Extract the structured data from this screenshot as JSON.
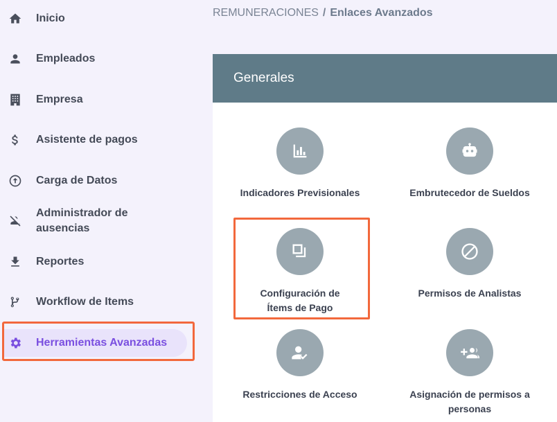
{
  "sidebar": {
    "items": [
      {
        "label": "Inicio",
        "icon": "home-icon"
      },
      {
        "label": "Empleados",
        "icon": "person-icon"
      },
      {
        "label": "Empresa",
        "icon": "building-icon"
      },
      {
        "label": "Asistente de pagos",
        "icon": "dollar-icon"
      },
      {
        "label": "Carga de Datos",
        "icon": "upload-circle-icon"
      },
      {
        "label": "Administrador de ausencias",
        "icon": "person-off-icon"
      },
      {
        "label": "Reportes",
        "icon": "download-icon"
      },
      {
        "label": "Workflow de Items",
        "icon": "branch-icon"
      },
      {
        "label": "Herramientas Avanzadas",
        "icon": "gear-icon",
        "active": true
      }
    ]
  },
  "breadcrumb": {
    "root": "REMUNERACIONES",
    "separator": "/",
    "current": "Enlaces Avanzados"
  },
  "panel": {
    "title": "Generales",
    "tools": [
      {
        "label": "Indicadores Previsionales",
        "icon": "bar-chart-icon"
      },
      {
        "label": "Embrutecedor de Sueldos",
        "icon": "robot-icon"
      },
      {
        "label": "Configuración de Ítems de Pago",
        "icon": "layers-icon"
      },
      {
        "label": "Permisos de Analistas",
        "icon": "block-icon"
      },
      {
        "label": "Restricciones de Acceso",
        "icon": "person-check-icon"
      },
      {
        "label": "Asignación de permisos a personas",
        "icon": "group-add-icon"
      }
    ]
  },
  "colors": {
    "accent": "#7a4fe0",
    "panel_header": "#5f7b88",
    "icon_circle": "#9aa8b0",
    "highlight": "#f2683c"
  }
}
